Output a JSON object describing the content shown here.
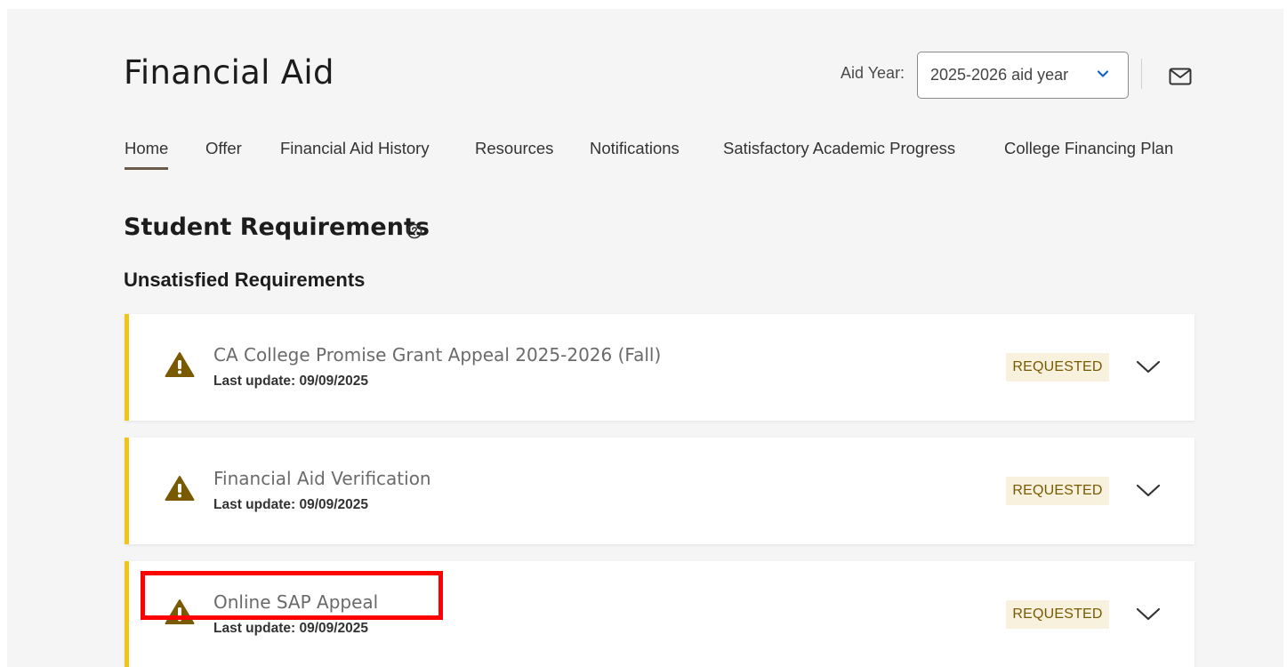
{
  "header": {
    "title": "Financial Aid",
    "aid_year_label": "Aid Year:",
    "aid_year_value": "2025-2026 aid year"
  },
  "nav": {
    "items": [
      {
        "label": "Home",
        "active": true
      },
      {
        "label": "Offer"
      },
      {
        "label": "Financial Aid History"
      },
      {
        "label": "Resources"
      },
      {
        "label": "Notifications"
      },
      {
        "label": "Satisfactory Academic Progress"
      },
      {
        "label": "College Financing Plan"
      }
    ]
  },
  "main": {
    "section_title": "Student Requirements",
    "subsection_title": "Unsatisfied Requirements",
    "requirements": [
      {
        "title": "CA College Promise Grant Appeal 2025-2026 (Fall)",
        "last_update": "Last update: 09/09/2025",
        "status": "REQUESTED"
      },
      {
        "title": "Financial Aid Verification",
        "last_update": "Last update: 09/09/2025",
        "status": "REQUESTED"
      },
      {
        "title": "Online SAP Appeal",
        "last_update": "Last update: 09/09/2025",
        "status": "REQUESTED"
      }
    ]
  },
  "colors": {
    "accent_bar": "#f0c419",
    "status_badge_bg": "#f7f1dd",
    "status_badge_text": "#7a5a00",
    "warning_icon": "#7a5a00",
    "annotation_box": "#ff0000",
    "select_chevron": "#1565c0"
  },
  "icons": {
    "help": "help-circle-icon",
    "warning": "warning-triangle-icon",
    "expand": "chevron-down-icon",
    "mail": "mail-icon"
  }
}
